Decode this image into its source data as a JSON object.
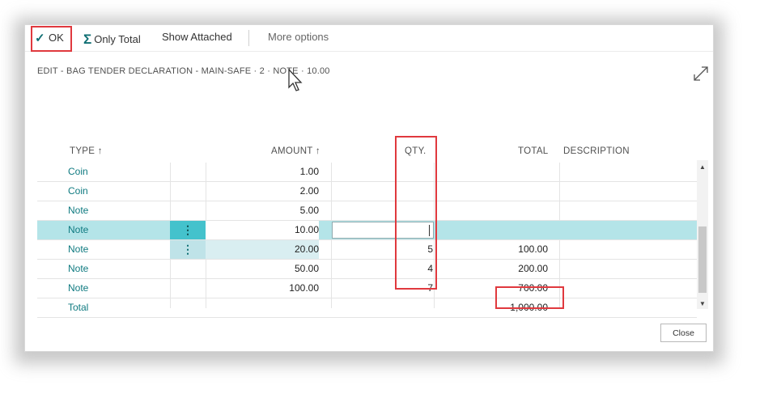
{
  "actions": {
    "ok_label": "OK",
    "only_total_label": "Only Total",
    "show_attached_label": "Show Attached",
    "more_options_label": "More options"
  },
  "title": "EDIT - BAG TENDER DECLARATION - MAIN-SAFE · 2 · NOTE · 10.00",
  "columns": {
    "type": "TYPE ↑",
    "amount": "AMOUNT ↑",
    "qty": "QTY.",
    "total": "TOTAL",
    "description": "DESCRIPTION"
  },
  "rows": [
    {
      "type": "Coin",
      "amount": "1.00",
      "qty": "",
      "total": ""
    },
    {
      "type": "Coin",
      "amount": "2.00",
      "qty": "",
      "total": ""
    },
    {
      "type": "Note",
      "amount": "5.00",
      "qty": "",
      "total": ""
    },
    {
      "type": "Note",
      "amount": "10.00",
      "qty": "",
      "total": ""
    },
    {
      "type": "Note",
      "amount": "20.00",
      "qty": "5",
      "total": "100.00"
    },
    {
      "type": "Note",
      "amount": "50.00",
      "qty": "4",
      "total": "200.00"
    },
    {
      "type": "Note",
      "amount": "100.00",
      "qty": "7",
      "total": "700.00"
    },
    {
      "type": "Total",
      "amount": "",
      "qty": "",
      "total": "1,000.00"
    }
  ],
  "row_menu_glyph": "⋮",
  "close_label": "Close",
  "colors": {
    "accent": "#0f7a80",
    "selected_row": "#b4e4e8",
    "annotation": "#e0393e"
  },
  "icons": [
    "checkmark-icon",
    "sigma-icon",
    "expand-icon",
    "row-actions-icon",
    "cursor-icon"
  ]
}
